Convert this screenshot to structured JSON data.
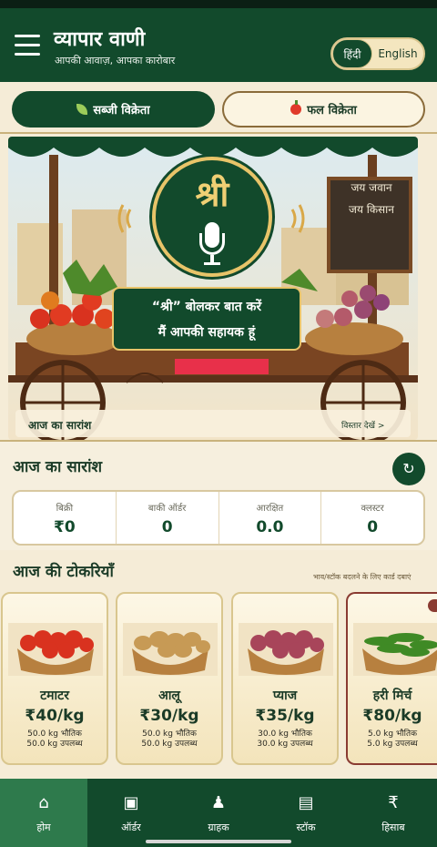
{
  "header": {
    "app_title": "व्यापार वाणी",
    "app_subtitle": "आपकी आवाज़, आपका कारोबार",
    "lang_hindi": "हिंदी",
    "lang_english": "English"
  },
  "vendor_types": {
    "veg_label": "सब्जी विक्रेता",
    "fruit_label": "फल विक्रेता"
  },
  "hero": {
    "voice_symbol": "श्री",
    "speech_line_1": "“श्री” बोलकर बात करें",
    "speech_line_2": "मैं आपकी सहायक हूं",
    "chalkboard_line_1": "जय जवान",
    "chalkboard_line_2": "जय किसान",
    "label_left": "आज का सारांश",
    "label_right": "विस्तार देखें >"
  },
  "summary": {
    "title": "आज का सारांश",
    "refresh_icon": "↻",
    "stats": [
      {
        "label": "बिक्री",
        "value": "₹0"
      },
      {
        "label": "बाकी ऑर्डर",
        "value": "0"
      },
      {
        "label": "आरक्षित",
        "value": "0.0"
      },
      {
        "label": "क्लस्टर",
        "value": "0"
      }
    ]
  },
  "baskets": {
    "title": "आज की टोकरियाँ",
    "hint": "भाव/स्टॉक बदलने के लिए कार्ड दबाएं",
    "items": [
      {
        "name": "टमाटर",
        "price": "₹40/kg",
        "physical": "50.0 kg भौतिक",
        "available": "50.0 kg उपलब्ध",
        "produce_color": "#d9321f"
      },
      {
        "name": "आलू",
        "price": "₹30/kg",
        "physical": "50.0 kg भौतिक",
        "available": "50.0 kg उपलब्ध",
        "produce_color": "#c79a55"
      },
      {
        "name": "प्याज",
        "price": "₹35/kg",
        "physical": "30.0 kg भौतिक",
        "available": "30.0 kg उपलब्ध",
        "produce_color": "#a8455a"
      },
      {
        "name": "हरी मिर्च",
        "price": "₹80/kg",
        "physical": "5.0 kg भौतिक",
        "available": "5.0 kg उपलब्ध",
        "produce_color": "#3f8a25"
      }
    ]
  },
  "nav": {
    "items": [
      {
        "label": "होम",
        "icon": "⌂"
      },
      {
        "label": "ऑर्डर",
        "icon": "▣"
      },
      {
        "label": "ग्राहक",
        "icon": "♟"
      },
      {
        "label": "स्टॉक",
        "icon": "▤"
      },
      {
        "label": "हिसाब",
        "icon": "₹"
      }
    ]
  },
  "colors": {
    "primary_green": "#124a2c",
    "cream": "#f5ecd7",
    "gold": "#e8c469",
    "alert_red": "#e8304a"
  }
}
